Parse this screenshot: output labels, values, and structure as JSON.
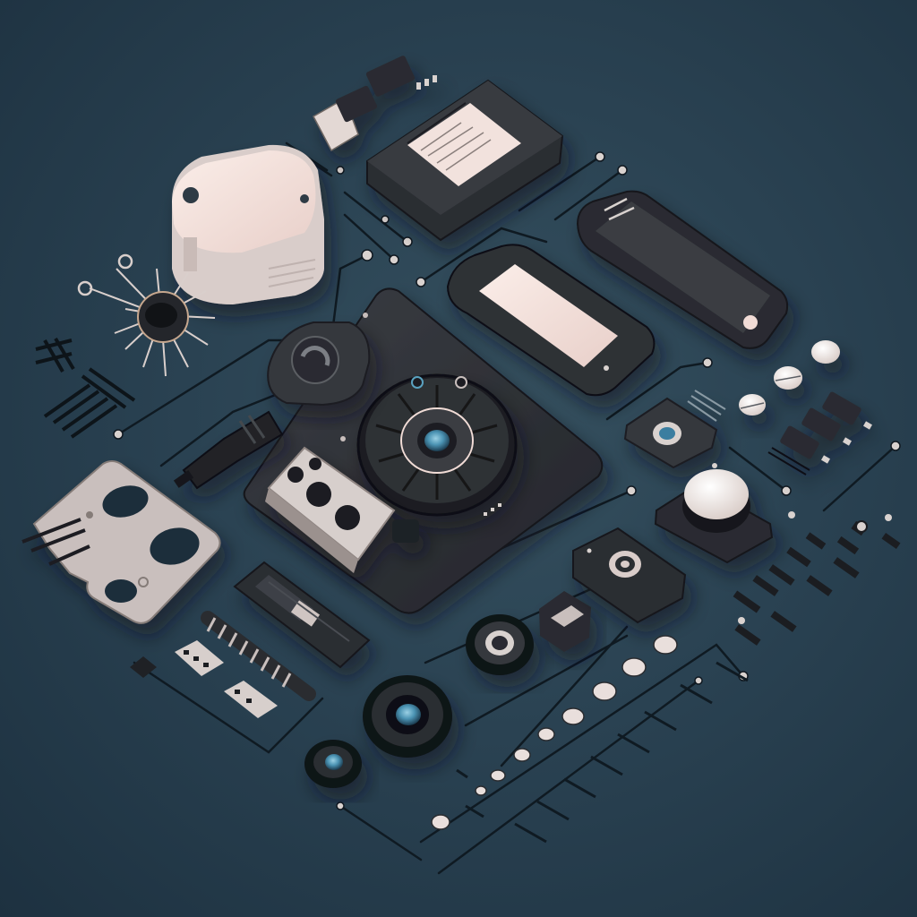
{
  "image": {
    "background_color": "#2c4656",
    "palette": {
      "device_dark": "#24262b",
      "device_mid": "#34373d",
      "device_edge": "#15171a",
      "cream": "#f1dcd6",
      "metal": "#c9bfbd",
      "lens_blue": "#5aa2c0",
      "wire": "#0f1a22"
    }
  }
}
